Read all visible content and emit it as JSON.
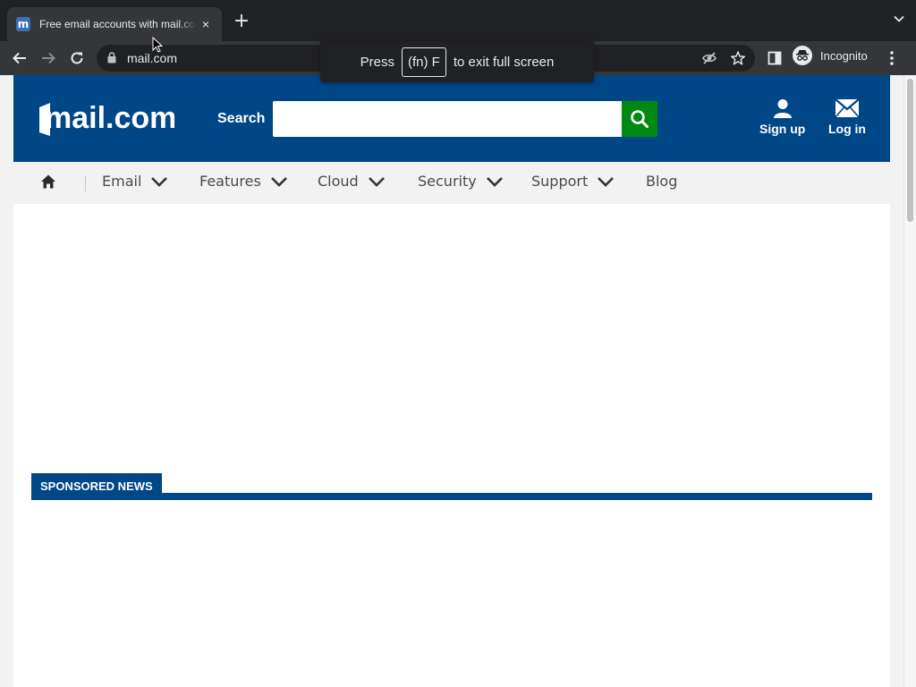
{
  "browser": {
    "tab": {
      "favicon": "m",
      "title": "Free email accounts with mail.com",
      "close_icon": "×"
    },
    "new_tab_icon": "+",
    "address": {
      "url": "mail.com"
    },
    "profile_label": "Incognito",
    "fullscreen_toast": {
      "prefix": "Press",
      "key": "(fn) F",
      "suffix": "to exit full screen"
    }
  },
  "header": {
    "logo_text": "mail.com",
    "search": {
      "label": "Search",
      "value": "",
      "placeholder": ""
    },
    "actions": [
      {
        "label": "Sign up",
        "icon": "user-icon"
      },
      {
        "label": "Log in",
        "icon": "envelope-icon"
      }
    ]
  },
  "nav": {
    "home_icon": "home-icon",
    "items": [
      {
        "label": "Email",
        "dropdown": true
      },
      {
        "label": "Features",
        "dropdown": true
      },
      {
        "label": "Cloud",
        "dropdown": true
      },
      {
        "label": "Security",
        "dropdown": true
      },
      {
        "label": "Support",
        "dropdown": true
      },
      {
        "label": "Blog",
        "dropdown": false
      }
    ]
  },
  "content": {
    "sponsored_label": "SPONSORED NEWS"
  },
  "colors": {
    "brand_blue": "#004788",
    "search_green": "#008a12",
    "chrome_dark": "#202124",
    "chrome_toolbar": "#35363a"
  }
}
